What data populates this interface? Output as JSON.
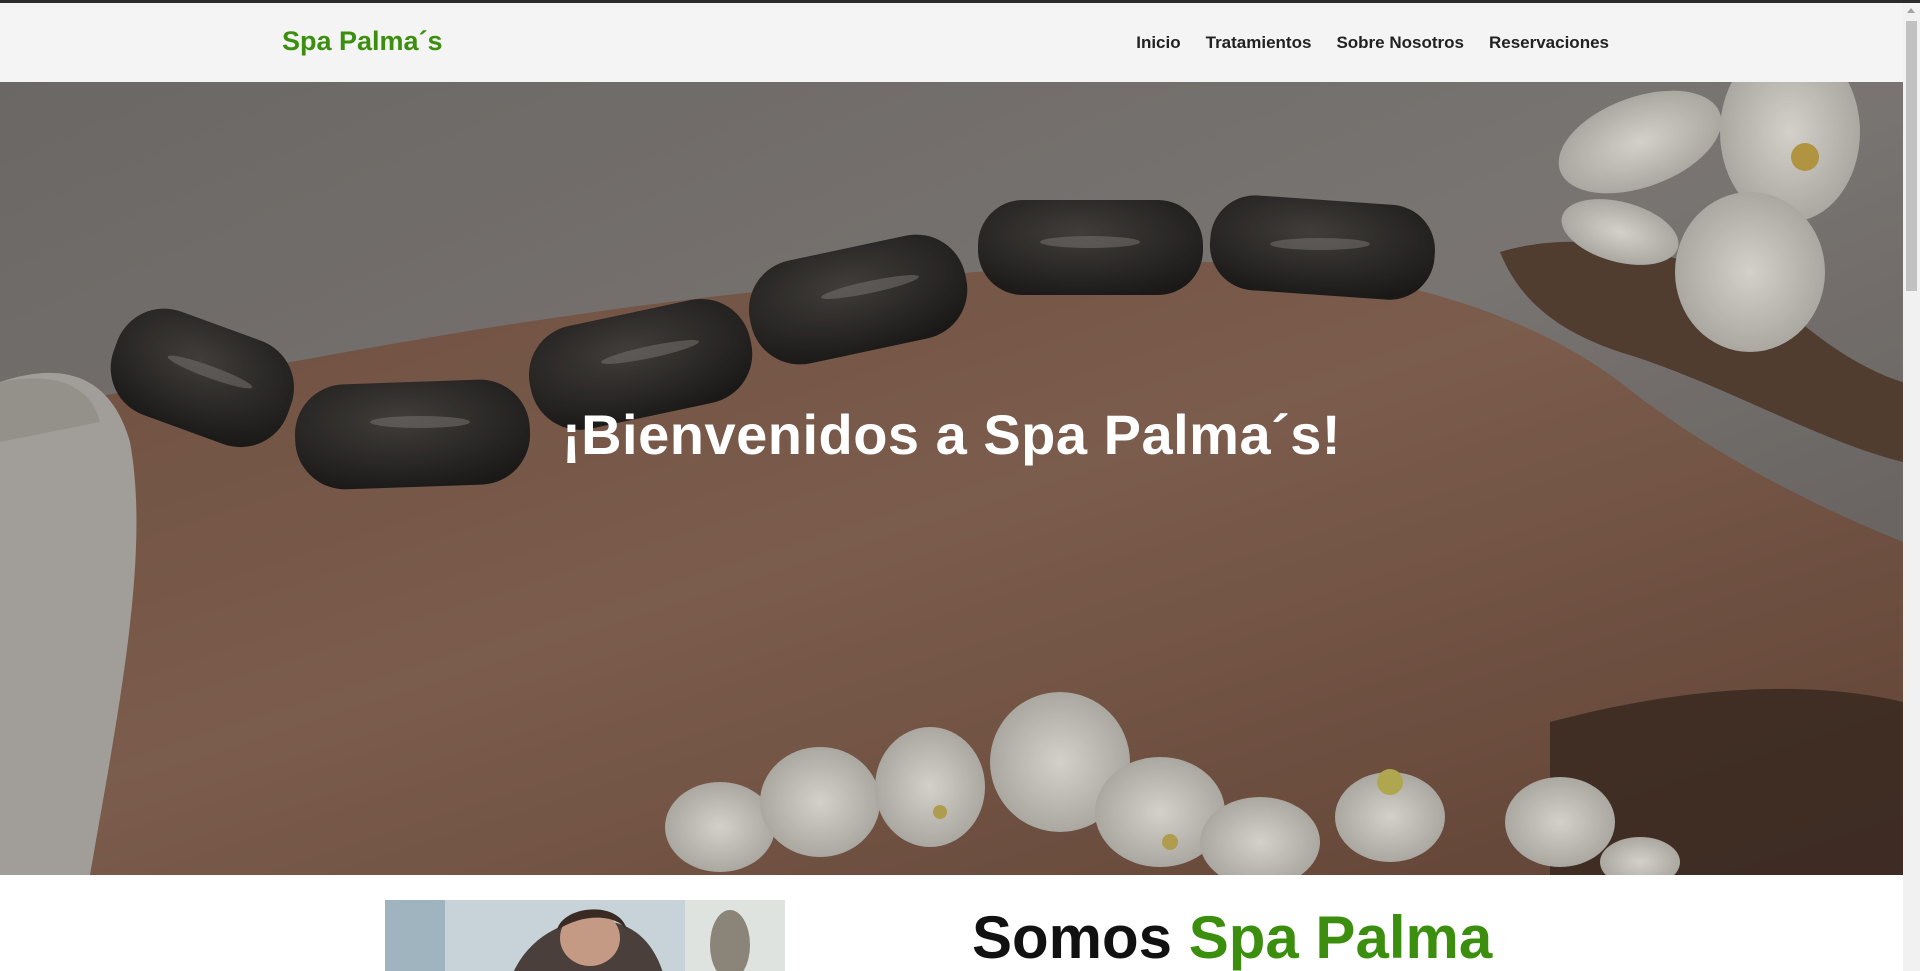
{
  "header": {
    "brand": "Spa Palma´s",
    "nav": [
      {
        "label": "Inicio"
      },
      {
        "label": "Tratamientos"
      },
      {
        "label": "Sobre Nosotros"
      },
      {
        "label": "Reservaciones"
      }
    ]
  },
  "hero": {
    "title": "¡Bienvenidos a Spa Palma´s!"
  },
  "about": {
    "title_plain": "Somos",
    "title_accent": "Spa Palma"
  },
  "colors": {
    "brand_green": "#3c8f0e",
    "header_bg": "#f4f4f4",
    "nav_text": "#222222"
  }
}
